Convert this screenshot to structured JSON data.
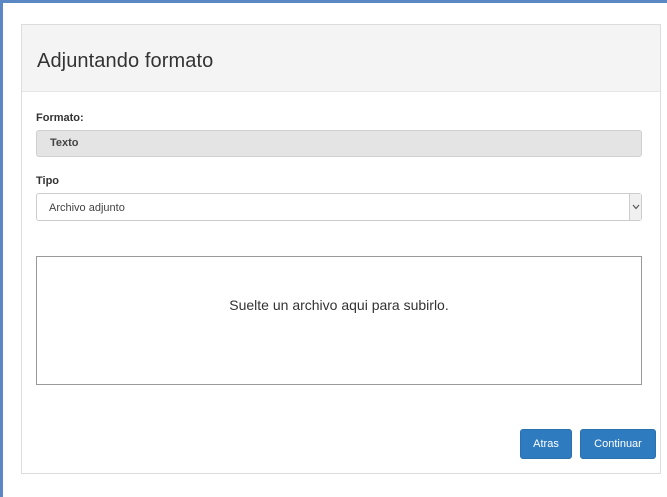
{
  "dialog": {
    "title": "Adjuntando formato"
  },
  "form": {
    "format_label": "Formato:",
    "format_value": "Texto",
    "type_label": "Tipo",
    "type_selected": "Archivo adjunto"
  },
  "dropzone": {
    "message": "Suelte un archivo aqui para subirlo."
  },
  "actions": {
    "back_label": "Atras",
    "continue_label": "Continuar"
  },
  "colors": {
    "primary_button": "#2f7bbf",
    "frame_border": "#5b87c5",
    "header_bg": "#f4f4f4",
    "readonly_bg": "#e4e4e4"
  }
}
